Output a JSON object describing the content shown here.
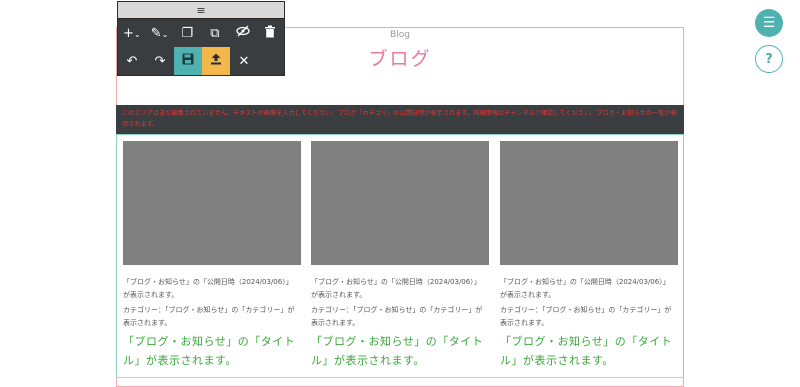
{
  "toolbar": {
    "icons": [
      "add-icon",
      "edit-icon",
      "copy-icon",
      "duplicate-icon",
      "hide-icon",
      "delete-icon",
      "undo-icon",
      "redo-icon",
      "save-icon",
      "upload-icon",
      "close-icon"
    ],
    "accent_save": "#4fb2b1",
    "accent_upload": "#f3b84c"
  },
  "section": {
    "en_title": "Blog",
    "ja_title": "ブログ"
  },
  "notice": "このエリアはまだ編集されていません。テキストや画像を入力してください。ブログ「カテゴリ」の公開日時が表示されます。詳細情報はチャンネルで確認してください。ブログ・お知らせの一覧が表示されます。",
  "cards": [
    {
      "meta_line1": "「ブログ・お知らせ」の「公開日時（2024/03/06）」が表示されます。",
      "meta_line2": "カテゴリー：「ブログ・お知らせ」の「カテゴリー」が表示されます。",
      "title": "「ブログ・お知らせ」の「タイトル」が表示されます。"
    },
    {
      "meta_line1": "「ブログ・お知らせ」の「公開日時（2024/03/06）」が表示されます。",
      "meta_line2": "カテゴリー：「ブログ・お知らせ」の「カテゴリー」が表示されます。",
      "title": "「ブログ・お知らせ」の「タイトル」が表示されます。"
    },
    {
      "meta_line1": "「ブログ・お知らせ」の「公開日時（2024/03/06）」が表示されます。",
      "meta_line2": "カテゴリー：「ブログ・お知らせ」の「カテゴリー」が表示されます。",
      "title": "「ブログ・お知らせ」の「タイトル」が表示されます。"
    }
  ],
  "side": {
    "menu_icon": "menu-icon",
    "help_label": "?"
  },
  "colors": {
    "accent_teal": "#4fb2b1",
    "title_pink": "#e8799a",
    "card_title_green": "#3aa83a",
    "notice_red": "#e63434"
  }
}
